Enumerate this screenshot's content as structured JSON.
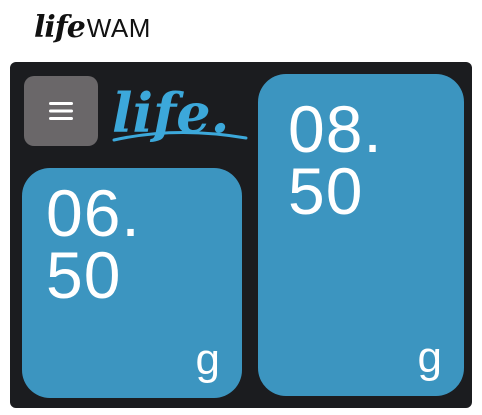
{
  "brand": {
    "script": "life",
    "text": "WAM"
  },
  "app_logo": {
    "text": "life."
  },
  "menu": {
    "icon": "hamburger-menu-icon"
  },
  "tiles": [
    {
      "value": "06.\n50",
      "unit": "g"
    },
    {
      "value": "08.\n50",
      "unit": "g"
    }
  ],
  "colors": {
    "device_bg": "#1b1c1f",
    "tile_bg": "#3c95c0",
    "logo_blue": "#3ca8da",
    "menu_button_bg": "#6a6769"
  }
}
